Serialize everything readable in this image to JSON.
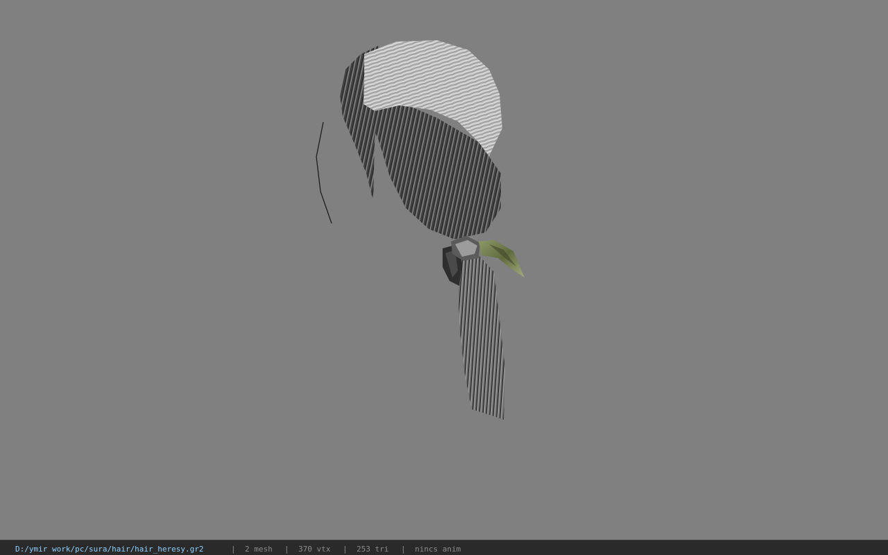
{
  "viewer": {
    "background_color": "#808080",
    "model_name": "hair_heresy"
  },
  "statusbar": {
    "file_path": "D:/ymir work/pc/sura/hair/hair_heresy.gr2",
    "separator": "|",
    "mesh_count": "2 mesh",
    "vertex_count": "370 vtx",
    "triangle_count": "253 tri",
    "animation": "nincs anim",
    "path_color": "#8fd0ff",
    "text_color": "#8c8c8c"
  }
}
